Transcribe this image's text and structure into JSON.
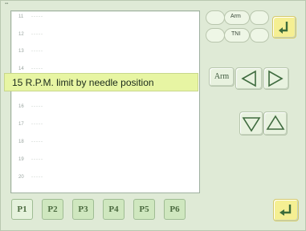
{
  "list": {
    "rows": [
      {
        "num": "11",
        "dashes": "-----"
      },
      {
        "num": "12",
        "dashes": "-----"
      },
      {
        "num": "13",
        "dashes": "-----"
      },
      {
        "num": "14",
        "dashes": "-----"
      },
      {
        "num": "16",
        "dashes": "-----"
      },
      {
        "num": "17",
        "dashes": "-----"
      },
      {
        "num": "18",
        "dashes": "-----"
      },
      {
        "num": "19",
        "dashes": "-----"
      },
      {
        "num": "20",
        "dashes": "-----"
      }
    ],
    "selected_item": "15 R.P.M. limit by needle position"
  },
  "controls": {
    "indicator_top": "Arm",
    "indicator_bottom": "TNI",
    "arm_button": "Arm"
  },
  "tabs": [
    {
      "label": "P1"
    },
    {
      "label": "P2"
    },
    {
      "label": "P3"
    },
    {
      "label": "P4"
    },
    {
      "label": "P5"
    },
    {
      "label": "P6"
    }
  ],
  "icons": {
    "back": "return-arrow-icon",
    "enter": "enter-arrow-icon",
    "left": "triangle-left-icon",
    "right": "triangle-right-icon",
    "down": "triangle-down-icon",
    "up": "triangle-up-icon"
  },
  "colors": {
    "selection": "#e7f5a3",
    "accent_yellow": "#f5ef93",
    "panel_bg": "#dfead6"
  }
}
